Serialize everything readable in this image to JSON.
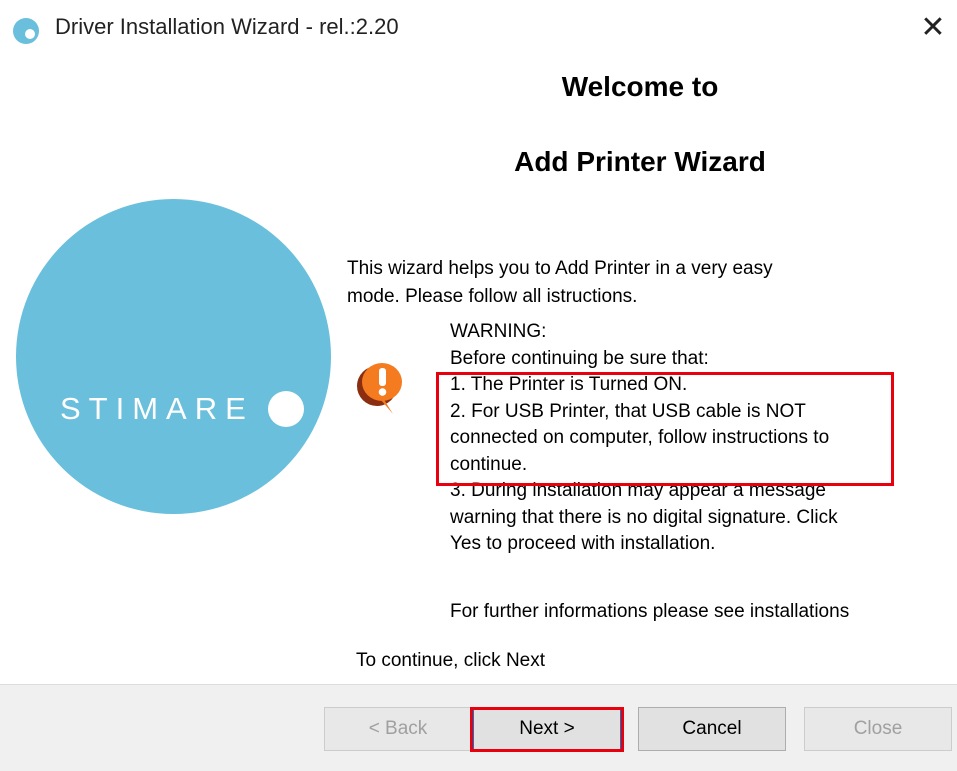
{
  "window": {
    "title": "Driver Installation Wizard - rel.:2.20",
    "close_glyph": "✕"
  },
  "logo": {
    "text": "STIMARE",
    "circle_color": "#69bfdc"
  },
  "header": {
    "line1": "Welcome to",
    "line2": "Add Printer Wizard"
  },
  "intro": {
    "line1": "This wizard helps you to Add Printer in a very easy",
    "line2": "mode. Please follow all istructions."
  },
  "warning": {
    "icon": "exclamation-bubble-icon",
    "icon_color": "#f47b20",
    "lines": [
      "WARNING:",
      "Before continuing be sure that:",
      "1. The Printer is Turned ON.",
      "2. For USB Printer, that USB cable is NOT",
      "connected on computer, follow instructions to",
      "continue.",
      "3. During installation may appear a  message",
      "warning that there is no digital signature. Click",
      "Yes to proceed with installation."
    ],
    "further": "For further informations please see installations"
  },
  "footer_note": "To continue, click Next",
  "buttons": {
    "back": "< Back",
    "next": "Next >",
    "cancel": "Cancel",
    "close": "Close"
  },
  "highlight_color": "#e8000c"
}
